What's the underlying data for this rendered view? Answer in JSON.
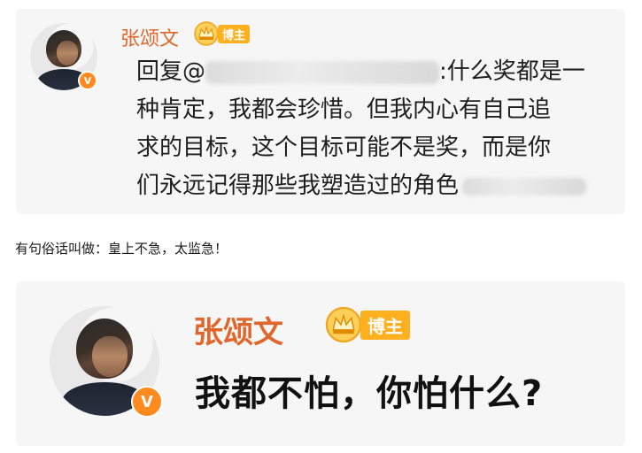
{
  "post_top": {
    "username": "张颂文",
    "badge_label": "博主",
    "reply_prefix": "回复@",
    "reply_lines": [
      ":什么奖都是一",
      "种肯定，我都会珍惜。但我内心有自己追",
      "求的目标，这个目标可能不是奖，而是你",
      "们永远记得那些我塑造过的角色"
    ],
    "verified_mark": "V"
  },
  "caption": "有句俗话叫做：皇上不急，太监急！",
  "post_bottom": {
    "username": "张颂文",
    "badge_label": "博主",
    "text": "我都不怕，你怕什么?",
    "verified_mark": "V"
  }
}
